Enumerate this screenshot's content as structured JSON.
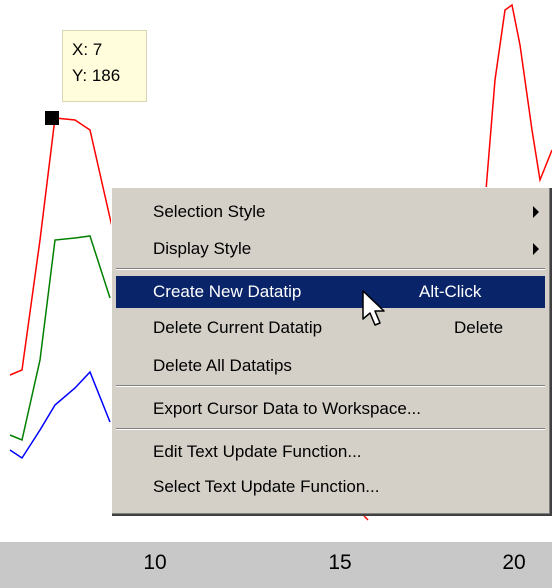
{
  "plot": {
    "x_ticks": [
      {
        "label": "10"
      },
      {
        "label": "15"
      },
      {
        "label": "20"
      }
    ],
    "series_colors": [
      "#ff0000",
      "#008000",
      "#0000ff"
    ]
  },
  "datatip": {
    "x_text": "X: 7",
    "y_text": "Y: 186"
  },
  "menu": {
    "items": [
      {
        "label": "Selection Style",
        "submenu": true
      },
      {
        "label": "Display Style",
        "submenu": true
      },
      {
        "label": "Create New Datatip",
        "shortcut": "Alt-Click",
        "highlighted": true
      },
      {
        "label": "Delete Current Datatip",
        "shortcut": "Delete"
      },
      {
        "label": "Delete All Datatips"
      },
      {
        "label": "Export Cursor Data to Workspace..."
      },
      {
        "label": "Edit Text Update Function..."
      },
      {
        "label": "Select Text Update Function..."
      }
    ],
    "highlight_color": "#0a246a",
    "background_color": "#d4d0c8"
  },
  "cursor": {
    "icon": "arrow-cursor-icon"
  }
}
